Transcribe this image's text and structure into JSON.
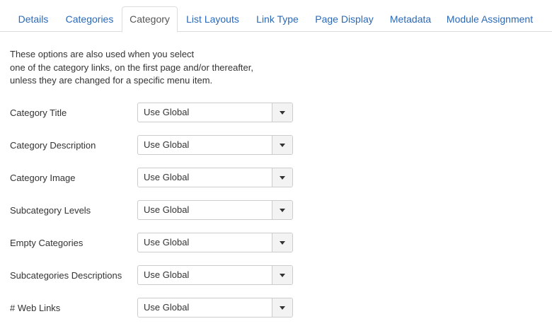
{
  "tabs": [
    {
      "label": "Details",
      "active": false
    },
    {
      "label": "Categories",
      "active": false
    },
    {
      "label": "Category",
      "active": true
    },
    {
      "label": "List Layouts",
      "active": false
    },
    {
      "label": "Link Type",
      "active": false
    },
    {
      "label": "Page Display",
      "active": false
    },
    {
      "label": "Metadata",
      "active": false
    },
    {
      "label": "Module Assignment",
      "active": false
    }
  ],
  "intro": {
    "lines": [
      "These options are also used when you select",
      "one of the category links, on the first page and/or thereafter,",
      "unless they are changed for a specific menu item."
    ]
  },
  "fields": [
    {
      "label": "Category Title",
      "value": "Use Global",
      "icon": "chevron-down-icon"
    },
    {
      "label": "Category Description",
      "value": "Use Global",
      "icon": "chevron-down-icon"
    },
    {
      "label": "Category Image",
      "value": "Use Global",
      "icon": "chevron-down-icon"
    },
    {
      "label": "Subcategory Levels",
      "value": "Use Global",
      "icon": "chevron-down-icon"
    },
    {
      "label": "Empty Categories",
      "value": "Use Global",
      "icon": "chevron-down-icon"
    },
    {
      "label": "Subcategories Descriptions",
      "value": "Use Global",
      "icon": "chevron-down-icon"
    },
    {
      "label": "# Web Links",
      "value": "Use Global",
      "icon": "chevron-down-icon"
    }
  ],
  "colors": {
    "link": "#2a69b8",
    "text": "#333333",
    "border": "#cccccc",
    "tab_border": "#dddddd",
    "arrow_bg": "#f3f3f3"
  }
}
